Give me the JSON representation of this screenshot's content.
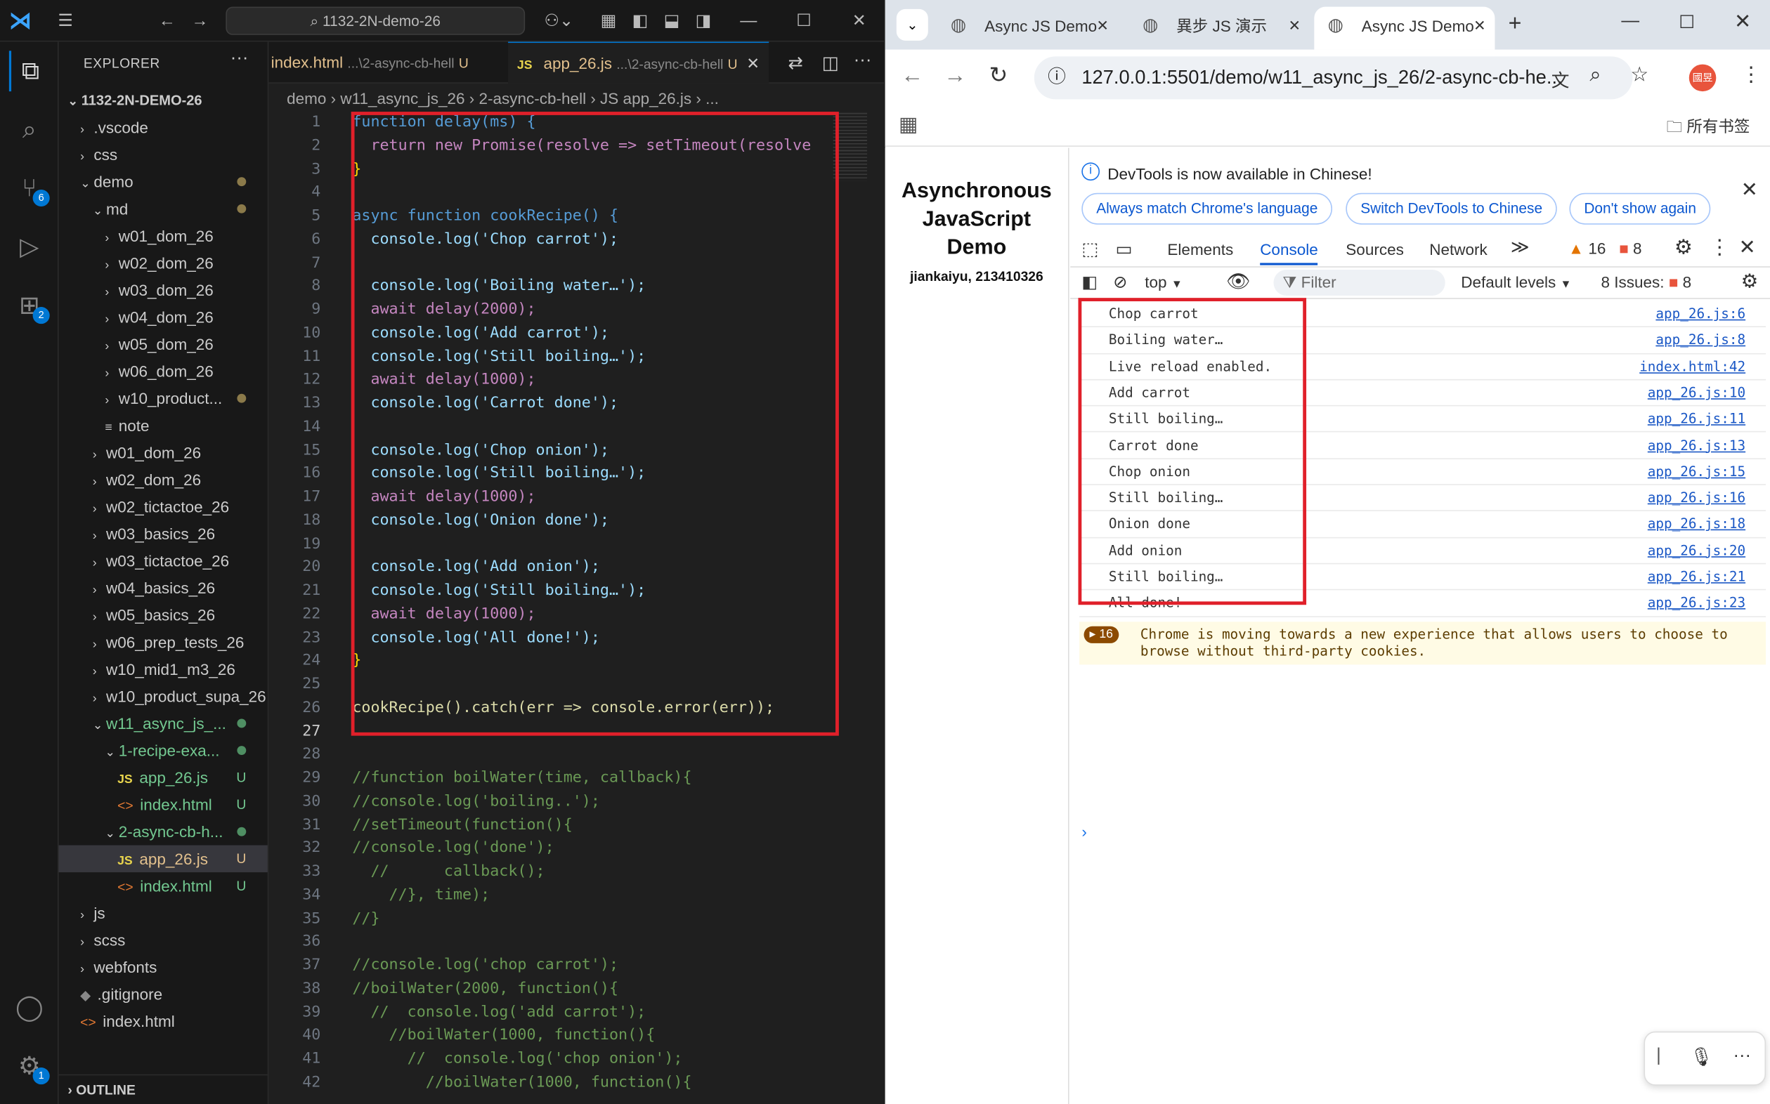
{
  "vscode": {
    "search_text": "1132-2N-demo-26",
    "explorer_title": "EXPLORER",
    "root_folder": "1132-2N-DEMO-26",
    "source_control_badge": "6",
    "extensions_badge": "2",
    "settings_badge": "1",
    "outline_label": "OUTLINE",
    "tree": [
      {
        "label": ".vscode",
        "indent": 1,
        "chev": "›"
      },
      {
        "label": "css",
        "indent": 1,
        "chev": "›"
      },
      {
        "label": "demo",
        "indent": 1,
        "chev": "⌄",
        "dot": true
      },
      {
        "label": "md",
        "indent": 2,
        "chev": "⌄",
        "dot": true
      },
      {
        "label": "w01_dom_26",
        "indent": 3,
        "chev": "›"
      },
      {
        "label": "w02_dom_26",
        "indent": 3,
        "chev": "›"
      },
      {
        "label": "w03_dom_26",
        "indent": 3,
        "chev": "›"
      },
      {
        "label": "w04_dom_26",
        "indent": 3,
        "chev": "›"
      },
      {
        "label": "w05_dom_26",
        "indent": 3,
        "chev": "›"
      },
      {
        "label": "w06_dom_26",
        "indent": 3,
        "chev": "›"
      },
      {
        "label": "w10_product...",
        "indent": 3,
        "chev": "›",
        "dot": true
      },
      {
        "label": "note",
        "indent": 3,
        "chev": "≡"
      },
      {
        "label": "w01_dom_26",
        "indent": 2,
        "chev": "›"
      },
      {
        "label": "w02_dom_26",
        "indent": 2,
        "chev": "›"
      },
      {
        "label": "w02_tictactoe_26",
        "indent": 2,
        "chev": "›"
      },
      {
        "label": "w03_basics_26",
        "indent": 2,
        "chev": "›"
      },
      {
        "label": "w03_tictactoe_26",
        "indent": 2,
        "chev": "›"
      },
      {
        "label": "w04_basics_26",
        "indent": 2,
        "chev": "›"
      },
      {
        "label": "w05_basics_26",
        "indent": 2,
        "chev": "›"
      },
      {
        "label": "w06_prep_tests_26",
        "indent": 2,
        "chev": "›"
      },
      {
        "label": "w10_mid1_m3_26",
        "indent": 2,
        "chev": "›"
      },
      {
        "label": "w10_product_supa_26",
        "indent": 2,
        "chev": "›"
      },
      {
        "label": "w11_async_js_...",
        "indent": 2,
        "chev": "⌄",
        "green": true,
        "gdot": true
      },
      {
        "label": "1-recipe-exa...",
        "indent": 3,
        "chev": "⌄",
        "green": true,
        "gdot": true
      },
      {
        "label": "app_26.js",
        "indent": 4,
        "file": "js",
        "green": true,
        "u": "U"
      },
      {
        "label": "index.html",
        "indent": 4,
        "file": "html",
        "green": true,
        "u": "U"
      },
      {
        "label": "2-async-cb-h...",
        "indent": 3,
        "chev": "⌄",
        "green": true,
        "gdot": true
      },
      {
        "label": "app_26.js",
        "indent": 4,
        "file": "js",
        "green": true,
        "u": "U",
        "sel": true
      },
      {
        "label": "index.html",
        "indent": 4,
        "file": "html",
        "green": true,
        "u": "U"
      },
      {
        "label": "js",
        "indent": 1,
        "chev": "›"
      },
      {
        "label": "scss",
        "indent": 1,
        "chev": "›"
      },
      {
        "label": "webfonts",
        "indent": 1,
        "chev": "›"
      },
      {
        "label": ".gitignore",
        "indent": 1,
        "file": "git"
      },
      {
        "label": "index.html",
        "indent": 1,
        "file": "html"
      }
    ],
    "tab1_label": "index.html",
    "tab1_path": "...\\2-async-cb-hell",
    "tab1_status": "U",
    "tab2_label": "app_26.js",
    "tab2_path": "...\\2-async-cb-hell",
    "tab2_status": "U",
    "breadcrumb": "demo › w11_async_js_26 › 2-async-cb-hell › JS app_26.js › ...",
    "code_lines": [
      "function delay(ms) {",
      "  return new Promise(resolve => setTimeout(resolve",
      "}",
      "",
      "async function cookRecipe() {",
      "  console.log('Chop carrot');",
      "",
      "  console.log('Boiling water…');",
      "  await delay(2000);",
      "  console.log('Add carrot');",
      "  console.log('Still boiling…');",
      "  await delay(1000);",
      "  console.log('Carrot done');",
      "",
      "  console.log('Chop onion');",
      "  console.log('Still boiling…');",
      "  await delay(1000);",
      "  console.log('Onion done');",
      "",
      "  console.log('Add onion');",
      "  console.log('Still boiling…');",
      "  await delay(1000);",
      "  console.log('All done!');",
      "}",
      "",
      "cookRecipe().catch(err => console.error(err));",
      "",
      "",
      "//function boilWater(time, callback){",
      "//console.log('boiling..');",
      "//setTimeout(function(){",
      "//console.log('done');",
      "  //      callback();",
      "    //}, time);",
      "//}",
      "",
      "//console.log('chop carrot');",
      "//boilWater(2000, function(){",
      "  //  console.log('add carrot');",
      "    //boilWater(1000, function(){",
      "      //  console.log('chop onion');",
      "        //boilWater(1000, function(){"
    ]
  },
  "chrome": {
    "tabs": [
      {
        "label": "Async JS Demo"
      },
      {
        "label": "異步 JS 演示"
      },
      {
        "label": "Async JS Demo",
        "active": true
      }
    ],
    "url": "127.0.0.1:5501/demo/w11_async_js_26/2-async-cb-he...",
    "profile_label": "國昱",
    "bookmarks_label": "所有书签",
    "page_title": "Asynchronous JavaScript Demo",
    "page_subtitle": "jiankaiyu, 213410326",
    "devtools": {
      "info_text": "DevTools is now available in Chinese!",
      "btn_match": "Always match Chrome's language",
      "btn_switch": "Switch DevTools to Chinese",
      "btn_dont": "Don't show again",
      "tabs": [
        "Elements",
        "Console",
        "Sources",
        "Network"
      ],
      "active_tab": "Console",
      "warn_count": "16",
      "err_count": "8",
      "context": "top",
      "filter_placeholder": "Filter",
      "levels": "Default levels",
      "issues_label": "8 Issues:",
      "issues_count": "8",
      "console_rows": [
        {
          "msg": "Chop carrot",
          "src": "app_26.js:6"
        },
        {
          "msg": "Boiling water…",
          "src": "app_26.js:8"
        },
        {
          "msg": "Live reload enabled.",
          "src": "index.html:42"
        },
        {
          "msg": "Add carrot",
          "src": "app_26.js:10"
        },
        {
          "msg": "Still boiling…",
          "src": "app_26.js:11"
        },
        {
          "msg": "Carrot done",
          "src": "app_26.js:13"
        },
        {
          "msg": "Chop onion",
          "src": "app_26.js:15"
        },
        {
          "msg": "Still boiling…",
          "src": "app_26.js:16"
        },
        {
          "msg": "Onion done",
          "src": "app_26.js:18"
        },
        {
          "msg": "Add onion",
          "src": "app_26.js:20"
        },
        {
          "msg": "Still boiling…",
          "src": "app_26.js:21"
        },
        {
          "msg": "All done!",
          "src": "app_26.js:23"
        }
      ],
      "warning_badge": "16",
      "warning_text": "Chrome is moving towards a new experience that allows users to choose to browse without third-party cookies."
    }
  }
}
